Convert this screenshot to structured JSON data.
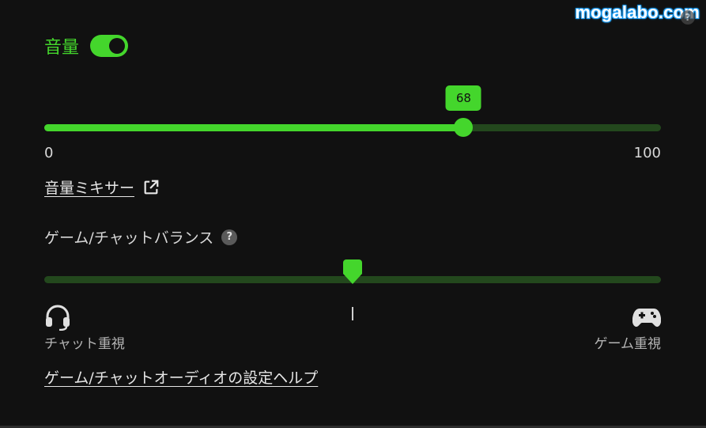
{
  "watermark": "mogalabo.com",
  "volume": {
    "label": "音量",
    "enabled": true,
    "value": 68,
    "value_text": "68",
    "min_label": "0",
    "max_label": "100"
  },
  "mixer_link": {
    "label": "音量ミキサー",
    "icon": "external-link-icon"
  },
  "balance": {
    "title": "ゲーム/チャットバランス",
    "help_icon": "question-icon",
    "value_fraction": 0.5,
    "left_label": "チャット重視",
    "left_icon": "headset-icon",
    "right_label": "ゲーム重視",
    "right_icon": "gamepad-icon"
  },
  "help_link": {
    "label": "ゲーム/チャットオーディオの設定ヘルプ"
  },
  "colors": {
    "accent": "#44d62c",
    "track_bg": "#23481d",
    "background": "#111111"
  }
}
